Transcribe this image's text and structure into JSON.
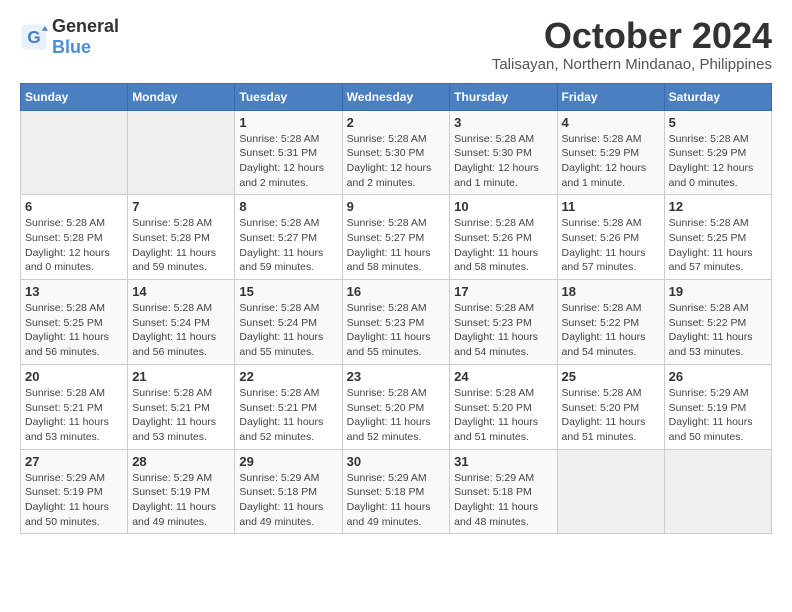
{
  "logo": {
    "general": "General",
    "blue": "Blue"
  },
  "header": {
    "month": "October 2024",
    "location": "Talisayan, Northern Mindanao, Philippines"
  },
  "weekdays": [
    "Sunday",
    "Monday",
    "Tuesday",
    "Wednesday",
    "Thursday",
    "Friday",
    "Saturday"
  ],
  "weeks": [
    [
      {
        "day": "",
        "sunrise": "",
        "sunset": "",
        "daylight": ""
      },
      {
        "day": "",
        "sunrise": "",
        "sunset": "",
        "daylight": ""
      },
      {
        "day": "1",
        "sunrise": "Sunrise: 5:28 AM",
        "sunset": "Sunset: 5:31 PM",
        "daylight": "Daylight: 12 hours and 2 minutes."
      },
      {
        "day": "2",
        "sunrise": "Sunrise: 5:28 AM",
        "sunset": "Sunset: 5:30 PM",
        "daylight": "Daylight: 12 hours and 2 minutes."
      },
      {
        "day": "3",
        "sunrise": "Sunrise: 5:28 AM",
        "sunset": "Sunset: 5:30 PM",
        "daylight": "Daylight: 12 hours and 1 minute."
      },
      {
        "day": "4",
        "sunrise": "Sunrise: 5:28 AM",
        "sunset": "Sunset: 5:29 PM",
        "daylight": "Daylight: 12 hours and 1 minute."
      },
      {
        "day": "5",
        "sunrise": "Sunrise: 5:28 AM",
        "sunset": "Sunset: 5:29 PM",
        "daylight": "Daylight: 12 hours and 0 minutes."
      }
    ],
    [
      {
        "day": "6",
        "sunrise": "Sunrise: 5:28 AM",
        "sunset": "Sunset: 5:28 PM",
        "daylight": "Daylight: 12 hours and 0 minutes."
      },
      {
        "day": "7",
        "sunrise": "Sunrise: 5:28 AM",
        "sunset": "Sunset: 5:28 PM",
        "daylight": "Daylight: 11 hours and 59 minutes."
      },
      {
        "day": "8",
        "sunrise": "Sunrise: 5:28 AM",
        "sunset": "Sunset: 5:27 PM",
        "daylight": "Daylight: 11 hours and 59 minutes."
      },
      {
        "day": "9",
        "sunrise": "Sunrise: 5:28 AM",
        "sunset": "Sunset: 5:27 PM",
        "daylight": "Daylight: 11 hours and 58 minutes."
      },
      {
        "day": "10",
        "sunrise": "Sunrise: 5:28 AM",
        "sunset": "Sunset: 5:26 PM",
        "daylight": "Daylight: 11 hours and 58 minutes."
      },
      {
        "day": "11",
        "sunrise": "Sunrise: 5:28 AM",
        "sunset": "Sunset: 5:26 PM",
        "daylight": "Daylight: 11 hours and 57 minutes."
      },
      {
        "day": "12",
        "sunrise": "Sunrise: 5:28 AM",
        "sunset": "Sunset: 5:25 PM",
        "daylight": "Daylight: 11 hours and 57 minutes."
      }
    ],
    [
      {
        "day": "13",
        "sunrise": "Sunrise: 5:28 AM",
        "sunset": "Sunset: 5:25 PM",
        "daylight": "Daylight: 11 hours and 56 minutes."
      },
      {
        "day": "14",
        "sunrise": "Sunrise: 5:28 AM",
        "sunset": "Sunset: 5:24 PM",
        "daylight": "Daylight: 11 hours and 56 minutes."
      },
      {
        "day": "15",
        "sunrise": "Sunrise: 5:28 AM",
        "sunset": "Sunset: 5:24 PM",
        "daylight": "Daylight: 11 hours and 55 minutes."
      },
      {
        "day": "16",
        "sunrise": "Sunrise: 5:28 AM",
        "sunset": "Sunset: 5:23 PM",
        "daylight": "Daylight: 11 hours and 55 minutes."
      },
      {
        "day": "17",
        "sunrise": "Sunrise: 5:28 AM",
        "sunset": "Sunset: 5:23 PM",
        "daylight": "Daylight: 11 hours and 54 minutes."
      },
      {
        "day": "18",
        "sunrise": "Sunrise: 5:28 AM",
        "sunset": "Sunset: 5:22 PM",
        "daylight": "Daylight: 11 hours and 54 minutes."
      },
      {
        "day": "19",
        "sunrise": "Sunrise: 5:28 AM",
        "sunset": "Sunset: 5:22 PM",
        "daylight": "Daylight: 11 hours and 53 minutes."
      }
    ],
    [
      {
        "day": "20",
        "sunrise": "Sunrise: 5:28 AM",
        "sunset": "Sunset: 5:21 PM",
        "daylight": "Daylight: 11 hours and 53 minutes."
      },
      {
        "day": "21",
        "sunrise": "Sunrise: 5:28 AM",
        "sunset": "Sunset: 5:21 PM",
        "daylight": "Daylight: 11 hours and 53 minutes."
      },
      {
        "day": "22",
        "sunrise": "Sunrise: 5:28 AM",
        "sunset": "Sunset: 5:21 PM",
        "daylight": "Daylight: 11 hours and 52 minutes."
      },
      {
        "day": "23",
        "sunrise": "Sunrise: 5:28 AM",
        "sunset": "Sunset: 5:20 PM",
        "daylight": "Daylight: 11 hours and 52 minutes."
      },
      {
        "day": "24",
        "sunrise": "Sunrise: 5:28 AM",
        "sunset": "Sunset: 5:20 PM",
        "daylight": "Daylight: 11 hours and 51 minutes."
      },
      {
        "day": "25",
        "sunrise": "Sunrise: 5:28 AM",
        "sunset": "Sunset: 5:20 PM",
        "daylight": "Daylight: 11 hours and 51 minutes."
      },
      {
        "day": "26",
        "sunrise": "Sunrise: 5:29 AM",
        "sunset": "Sunset: 5:19 PM",
        "daylight": "Daylight: 11 hours and 50 minutes."
      }
    ],
    [
      {
        "day": "27",
        "sunrise": "Sunrise: 5:29 AM",
        "sunset": "Sunset: 5:19 PM",
        "daylight": "Daylight: 11 hours and 50 minutes."
      },
      {
        "day": "28",
        "sunrise": "Sunrise: 5:29 AM",
        "sunset": "Sunset: 5:19 PM",
        "daylight": "Daylight: 11 hours and 49 minutes."
      },
      {
        "day": "29",
        "sunrise": "Sunrise: 5:29 AM",
        "sunset": "Sunset: 5:18 PM",
        "daylight": "Daylight: 11 hours and 49 minutes."
      },
      {
        "day": "30",
        "sunrise": "Sunrise: 5:29 AM",
        "sunset": "Sunset: 5:18 PM",
        "daylight": "Daylight: 11 hours and 49 minutes."
      },
      {
        "day": "31",
        "sunrise": "Sunrise: 5:29 AM",
        "sunset": "Sunset: 5:18 PM",
        "daylight": "Daylight: 11 hours and 48 minutes."
      },
      {
        "day": "",
        "sunrise": "",
        "sunset": "",
        "daylight": ""
      },
      {
        "day": "",
        "sunrise": "",
        "sunset": "",
        "daylight": ""
      }
    ]
  ]
}
